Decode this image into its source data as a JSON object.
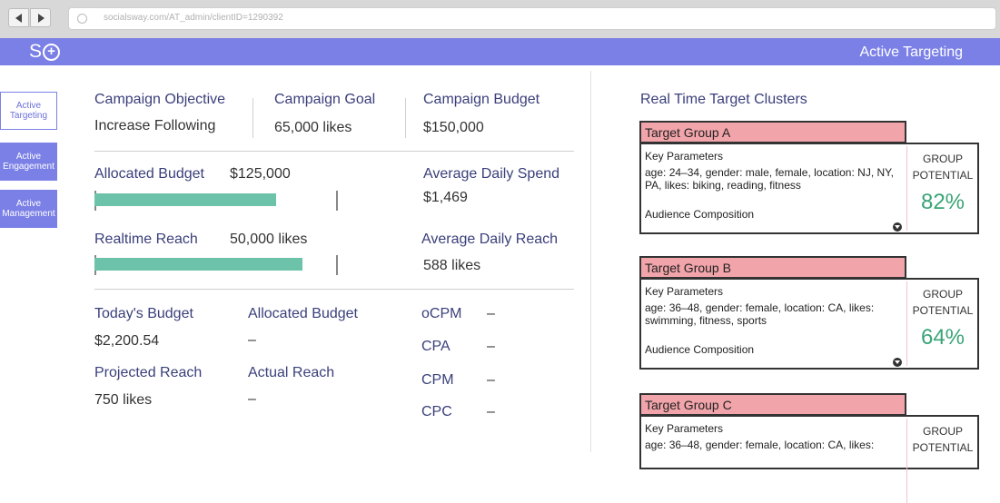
{
  "browser": {
    "url": "socialsway.com/AT_admin/clientID=1290392"
  },
  "app": {
    "logo_text": "S",
    "logo_symbol": "+",
    "title": "Active Targeting",
    "accent_color": "#7b80e6"
  },
  "sidenav": {
    "items": [
      {
        "label": "Active Targeting",
        "active": true
      },
      {
        "label": "Active Engagement",
        "active": false
      },
      {
        "label": "Active Management",
        "active": false
      }
    ]
  },
  "campaign": {
    "objective_label": "Campaign Objective",
    "objective_value": "Increase Following",
    "goal_label": "Campaign Goal",
    "goal_value": "65,000 likes",
    "budget_label": "Campaign Budget",
    "budget_value": "$150,000"
  },
  "progress": {
    "allocated_label": "Allocated Budget",
    "allocated_value": "$125,000",
    "allocated_fill": 0.75,
    "avg_spend_label": "Average Daily Spend",
    "avg_spend_value": "$1,469",
    "reach_label": "Realtime Reach",
    "reach_value": "50,000 likes",
    "reach_fill": 0.86,
    "avg_reach_label": "Average Daily Reach",
    "avg_reach_value": "588 likes"
  },
  "daily": {
    "todays_budget_label": "Today's Budget",
    "todays_budget_value": "$2,200.54",
    "allocated_budget_label": "Allocated Budget",
    "allocated_budget_value": "–",
    "projected_reach_label": "Projected Reach",
    "projected_reach_value": "750 likes",
    "actual_reach_label": "Actual Reach",
    "actual_reach_value": "–"
  },
  "metrics": [
    {
      "label": "oCPM",
      "value": "–"
    },
    {
      "label": "CPA",
      "value": "–"
    },
    {
      "label": "CPM",
      "value": "–"
    },
    {
      "label": "CPC",
      "value": "–"
    }
  ],
  "clusters": {
    "title": "Real Time Target Clusters",
    "header_color": "#f1a4aa",
    "potential_color": "#3aa476",
    "groups": [
      {
        "name": "Target Group A",
        "key_label": "Key Parameters",
        "params": "age: 24–34, gender: male, female, location: NJ, NY, PA, likes: biking, reading, fitness",
        "audience_label": "Audience Composition",
        "potential_label": "GROUP POTENTIAL",
        "potential_value": "82%"
      },
      {
        "name": "Target Group B",
        "key_label": "Key Parameters",
        "params": "age: 36–48, gender: female, location: CA, likes: swimming, fitness, sports",
        "audience_label": "Audience Composition",
        "potential_label": "GROUP POTENTIAL",
        "potential_value": "64%"
      },
      {
        "name": "Target Group C",
        "key_label": "Key Parameters",
        "params": "age: 36–48, gender: female, location: CA, likes:",
        "audience_label": "",
        "potential_label": "GROUP POTENTIAL",
        "potential_value": ""
      }
    ]
  }
}
